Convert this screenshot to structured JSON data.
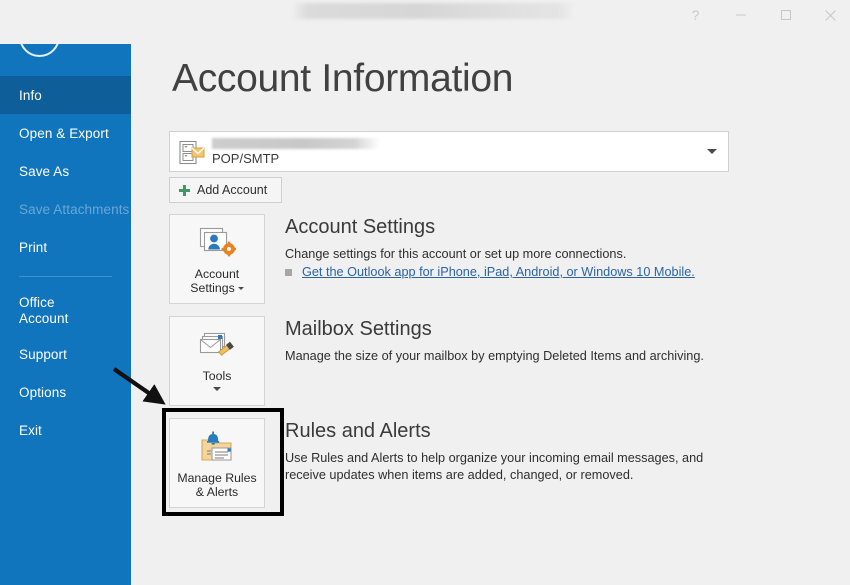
{
  "window": {
    "title_redacted": "",
    "controls": [
      {
        "name": "help",
        "glyph": "?"
      },
      {
        "name": "minimize",
        "glyph": "—"
      },
      {
        "name": "maximize",
        "glyph": "☐"
      },
      {
        "name": "close",
        "glyph": "✕"
      }
    ]
  },
  "sidebar": {
    "back_icon": "back-arrow-icon",
    "items": [
      {
        "label": "Info",
        "state": "active"
      },
      {
        "label": "Open & Export",
        "state": "normal"
      },
      {
        "label": "Save As",
        "state": "normal"
      },
      {
        "label": "Save Attachments",
        "state": "disabled"
      },
      {
        "label": "Print",
        "state": "normal"
      },
      {
        "label": "Office Account",
        "state": "normal",
        "line1": "Office",
        "line2": "Account"
      },
      {
        "label": "Support",
        "state": "normal"
      },
      {
        "label": "Options",
        "state": "normal"
      },
      {
        "label": "Exit",
        "state": "normal"
      }
    ]
  },
  "main": {
    "page_title": "Account Information",
    "account_selector": {
      "icon": "account-mail-icon",
      "name_redacted": "",
      "account_type": "POP/SMTP",
      "caret": "chevron-down-icon"
    },
    "add_account": {
      "label": "Add Account",
      "icon": "plus-icon"
    },
    "sections": [
      {
        "id": "account-settings",
        "tile_label_line1": "Account",
        "tile_label_line2": "Settings",
        "tile_icon": "account-settings-icon",
        "tile_has_inline_caret": true,
        "heading": "Account Settings",
        "description": "Change settings for this account or set up more connections.",
        "link": "Get the Outlook app for iPhone, iPad, Android, or Windows 10 Mobile."
      },
      {
        "id": "mailbox-settings",
        "tile_label_line1": "Tools",
        "tile_label_line2": "",
        "tile_icon": "mailbox-tools-icon",
        "tile_has_inline_caret": false,
        "heading": "Mailbox Settings",
        "description": "Manage the size of your mailbox by emptying Deleted Items and archiving.",
        "link": ""
      },
      {
        "id": "rules-and-alerts",
        "tile_label_line1": "Manage Rules",
        "tile_label_line2": "& Alerts",
        "tile_icon": "rules-alerts-icon",
        "tile_has_inline_caret": false,
        "heading": "Rules and Alerts",
        "description": "Use Rules and Alerts to help organize your incoming email messages, and receive updates when items are added, changed, or removed.",
        "link": ""
      }
    ]
  },
  "annotations": {
    "highlight_target": "rules-and-alerts-tile",
    "arrow": "pointer-arrow-icon",
    "highlight_color": "#000000"
  },
  "colors": {
    "sidebar_blue": "#1075bd",
    "sidebar_active_blue": "#0d5e99",
    "page_bg": "#f0f0f0",
    "link_blue": "#2a63a8",
    "accent_green": "#3d9a63",
    "accent_orange": "#e8821e"
  }
}
